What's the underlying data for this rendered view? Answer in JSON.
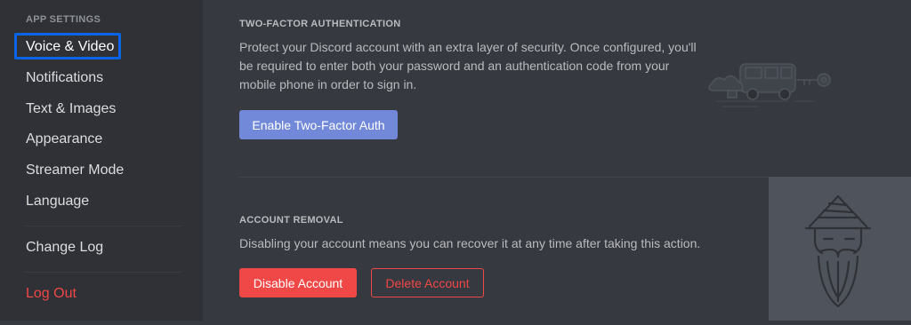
{
  "sidebar": {
    "header": "APP SETTINGS",
    "items": [
      {
        "label": "Voice & Video",
        "selected": true
      },
      {
        "label": "Notifications"
      },
      {
        "label": "Text & Images"
      },
      {
        "label": "Appearance"
      },
      {
        "label": "Streamer Mode"
      },
      {
        "label": "Language"
      }
    ],
    "changelog": "Change Log",
    "logout": "Log Out"
  },
  "two_factor": {
    "title": "TWO-FACTOR AUTHENTICATION",
    "description": "Protect your Discord account with an extra layer of security. Once configured, you'll be required to enter both your password and an authentication code from your mobile phone in order to sign in.",
    "button": "Enable Two-Factor Auth"
  },
  "account_removal": {
    "title": "ACCOUNT REMOVAL",
    "description": "Disabling your account means you can recover it at any time after taking this action.",
    "disable_button": "Disable Account",
    "delete_button": "Delete Account"
  },
  "colors": {
    "accent": "#7289da",
    "danger": "#f04747",
    "focus": "#0b63e6",
    "sidebar_bg": "#2f3136",
    "content_bg": "#36393f"
  },
  "icons": [
    "car-key-illustration",
    "wizard-illustration"
  ]
}
